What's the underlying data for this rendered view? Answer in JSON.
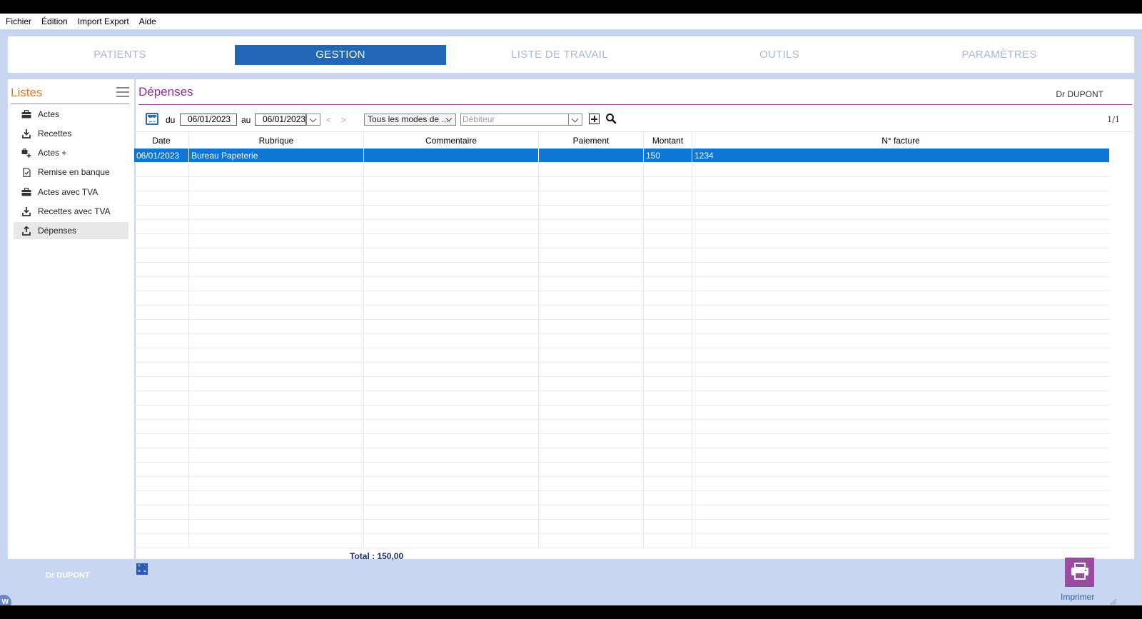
{
  "menu": {
    "items": [
      "Fichier",
      "Édition",
      "Import Export",
      "Aide"
    ]
  },
  "nav": {
    "tabs": [
      {
        "label": "PATIENTS",
        "active": false
      },
      {
        "label": "GESTION",
        "active": true
      },
      {
        "label": "LISTE DE TRAVAIL",
        "active": false
      },
      {
        "label": "OUTILS",
        "active": false
      },
      {
        "label": "PARAMÈTRES",
        "active": false
      }
    ]
  },
  "sidebar": {
    "title": "Listes",
    "items": [
      {
        "label": "Actes",
        "icon": "briefcase-icon",
        "selected": false
      },
      {
        "label": "Recettes",
        "icon": "download-icon",
        "selected": false
      },
      {
        "label": "Actes +",
        "icon": "briefcase-plus-icon",
        "selected": false
      },
      {
        "label": "Remise en banque",
        "icon": "document-check-icon",
        "selected": false
      },
      {
        "label": "Actes avec TVA",
        "icon": "briefcase-icon",
        "selected": false
      },
      {
        "label": "Recettes avec TVA",
        "icon": "download-icon",
        "selected": false
      },
      {
        "label": "Dépenses",
        "icon": "upload-icon",
        "selected": true
      }
    ]
  },
  "main": {
    "title": "Dépenses",
    "user": "Dr DUPONT",
    "toolbar": {
      "from_label": "du",
      "from_date": "06/01/2023",
      "to_label": "au",
      "to_date": "06/01/2023",
      "nav_arrows": "< >",
      "payment_mode": "Tous les modes de ...",
      "debtor_placeholder": "Débiteur",
      "pager": "1/1"
    },
    "table": {
      "columns": [
        "Date",
        "Rubrique",
        "Commentaire",
        "Paiement",
        "Montant",
        "N° facture"
      ],
      "rows": [
        {
          "date": "06/01/2023",
          "rubrique": "Bureau Papeterie",
          "commentaire": "",
          "paiement": "",
          "montant": "150",
          "facture": "1234"
        }
      ]
    }
  },
  "footer": {
    "total": "Total : 150,00",
    "user": "Dr DUPONT",
    "print_label": "Imprimer",
    "badge": "W"
  },
  "colors": {
    "accent_blue": "#2267b6",
    "selection_blue": "#0d76d6",
    "sidebar_orange": "#e07b2c",
    "title_purple": "#8f2f98",
    "app_background": "#c9d6ef"
  }
}
